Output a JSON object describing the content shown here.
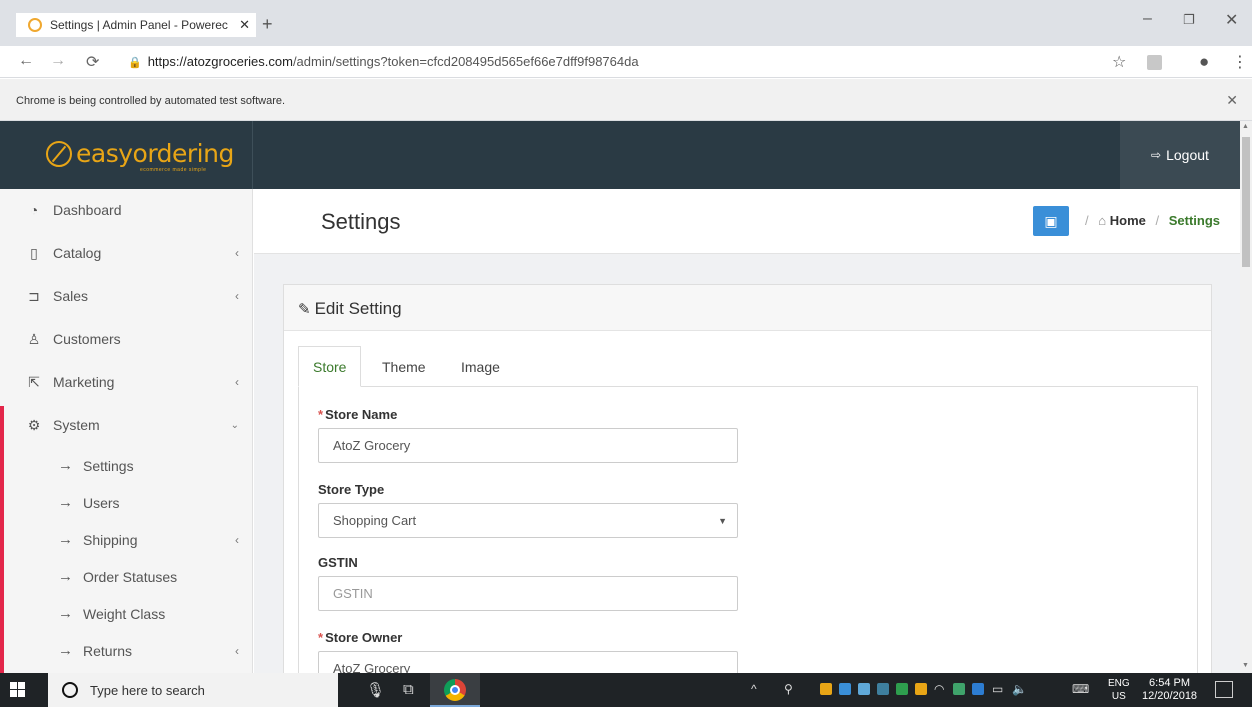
{
  "browser": {
    "tab_title": "Settings | Admin Panel - Powerec",
    "url_host": "https://atozgroceries.com",
    "url_path": "/admin/settings?token=cfcd208495d565ef66e7dff9f98764da",
    "automation_notice": "Chrome is being controlled by automated test software."
  },
  "header": {
    "logo_text": "easyordering",
    "logo_tagline": "ecommerce made simple",
    "logout_label": "Logout"
  },
  "sidebar": {
    "items": [
      {
        "label": "Dashboard",
        "icon": "dashboard-icon",
        "glyph": "⌂",
        "has_submenu": false
      },
      {
        "label": "Catalog",
        "icon": "tag-icon",
        "glyph": "⌂",
        "has_submenu": true
      },
      {
        "label": "Sales",
        "icon": "cart-icon",
        "glyph": "🛒",
        "has_submenu": true
      },
      {
        "label": "Customers",
        "icon": "user-icon",
        "glyph": "👤",
        "has_submenu": false
      },
      {
        "label": "Marketing",
        "icon": "share-icon",
        "glyph": "↗",
        "has_submenu": true
      },
      {
        "label": "System",
        "icon": "cog-icon",
        "glyph": "⚙",
        "has_submenu": true,
        "expanded": true
      }
    ],
    "system_subitems": [
      {
        "label": "Settings",
        "has_submenu": false
      },
      {
        "label": "Users",
        "has_submenu": false
      },
      {
        "label": "Shipping",
        "has_submenu": true
      },
      {
        "label": "Order Statuses",
        "has_submenu": false
      },
      {
        "label": "Weight Class",
        "has_submenu": false
      },
      {
        "label": "Returns",
        "has_submenu": true
      }
    ]
  },
  "page": {
    "title": "Settings",
    "breadcrumb": [
      "Home",
      "Settings"
    ],
    "card_title": "Edit Setting",
    "tabs": [
      "Store",
      "Theme",
      "Image"
    ],
    "active_tab": "Store"
  },
  "form": {
    "store_name": {
      "label": "Store Name",
      "required": true,
      "value": "AtoZ Grocery"
    },
    "store_type": {
      "label": "Store Type",
      "required": false,
      "value": "Shopping Cart"
    },
    "gstin": {
      "label": "GSTIN",
      "required": false,
      "value": "",
      "placeholder": "GSTIN"
    },
    "store_owner": {
      "label": "Store Owner",
      "required": true,
      "value": "AtoZ Grocery"
    }
  },
  "taskbar": {
    "search_placeholder": "Type here to search",
    "lang_line1": "ENG",
    "lang_line2": "US",
    "time": "6:54 PM",
    "date": "12/20/2018"
  },
  "colors": {
    "header_bg": "#2a3a44",
    "accent_gold": "#e8a516",
    "active_green": "#3b7a2c",
    "active_bar_red": "#e3264a",
    "save_blue": "#3a8fd8"
  }
}
